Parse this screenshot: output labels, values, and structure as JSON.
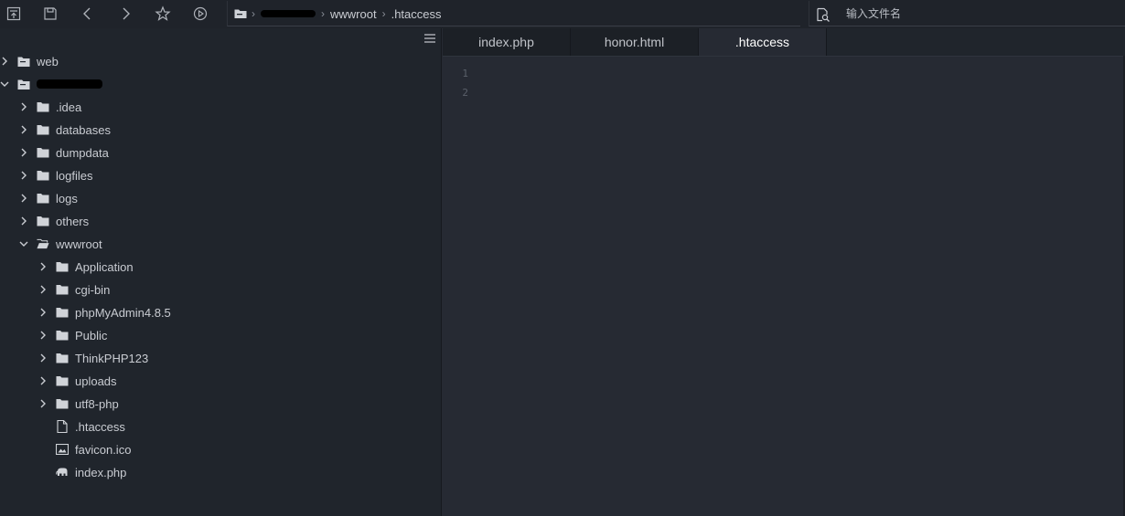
{
  "toolbar": {
    "icons": [
      "save-as-icon",
      "save-icon",
      "back-icon",
      "forward-icon",
      "star-icon",
      "play-icon"
    ]
  },
  "path": {
    "crumbs": [
      ".htaccess"
    ],
    "wwwroot": "wwwroot",
    "file": ".htaccess"
  },
  "search": {
    "placeholder": "输入文件名"
  },
  "tree": {
    "web": "web",
    "idea": ".idea",
    "databases": "databases",
    "dumpdata": "dumpdata",
    "logfiles": "logfiles",
    "logs": "logs",
    "others": "others",
    "wwwroot": "wwwroot",
    "application": "Application",
    "cgi_bin": "cgi-bin",
    "phpmyadmin": "phpMyAdmin4.8.5",
    "public": "Public",
    "thinkphp": "ThinkPHP123",
    "uploads": "uploads",
    "utf8_php": "utf8-php",
    "htaccess": ".htaccess",
    "favicon": "favicon.ico",
    "index_php": "index.php"
  },
  "tabs": {
    "t1": "index.php",
    "t2": "honor.html",
    "t3": ".htaccess"
  },
  "editor": {
    "lines": [
      "1",
      "2"
    ]
  },
  "colors": {
    "background": "#262a33",
    "sidebar": "#20252c",
    "toolbar": "#1f232a",
    "text": "#c9ccd2"
  }
}
